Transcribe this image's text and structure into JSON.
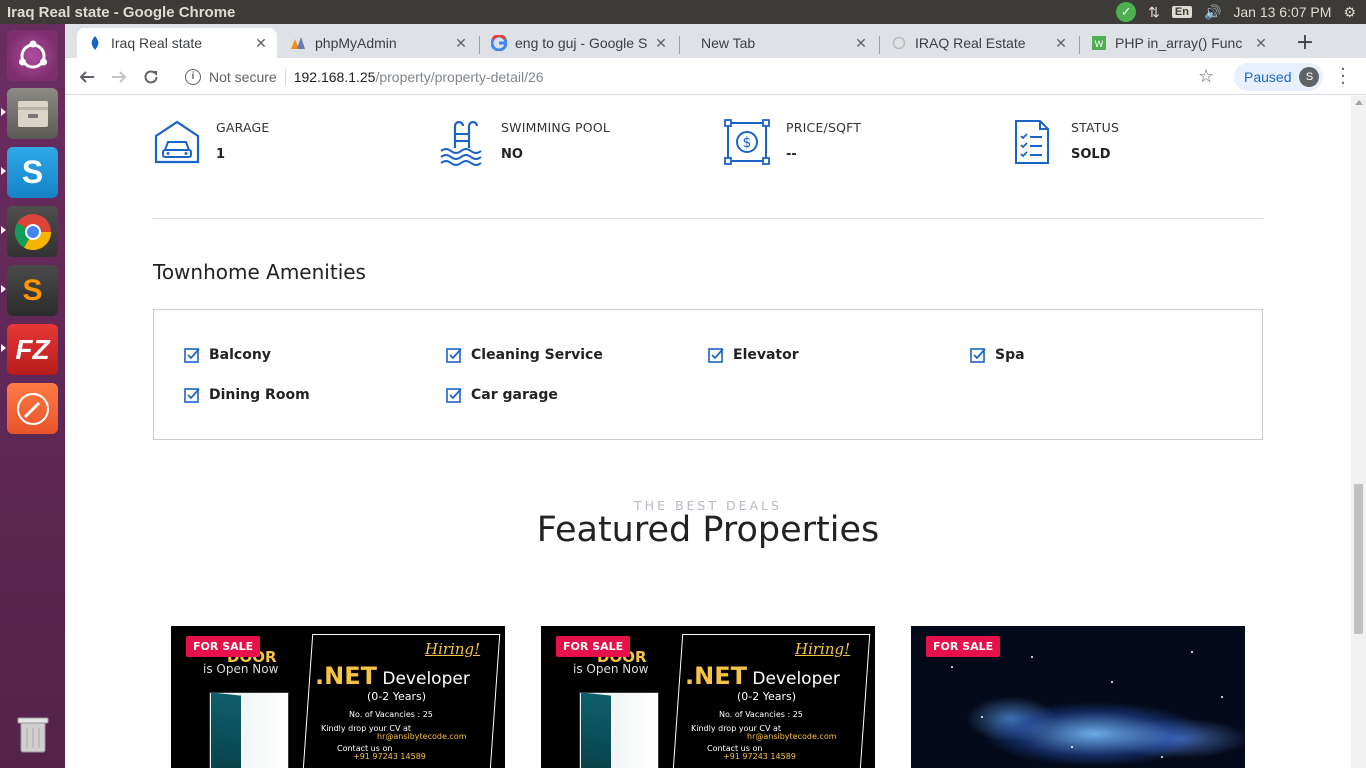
{
  "os": {
    "window_title": "Iraq Real state - Google Chrome",
    "clock": "Jan 13  6:07 PM",
    "keyboard": "En",
    "launcher": [
      "ubuntu-dash",
      "files",
      "skype",
      "chrome",
      "sublime-text",
      "filezilla",
      "postman",
      "trash"
    ]
  },
  "browser": {
    "tabs": [
      {
        "title": "Iraq Real state",
        "icon": "real-estate-favicon"
      },
      {
        "title": "phpMyAdmin",
        "icon": "phpmyadmin-favicon"
      },
      {
        "title": "eng to guj - Google S",
        "icon": "google-favicon"
      },
      {
        "title": "New Tab",
        "icon": ""
      },
      {
        "title": "IRAQ Real Estate",
        "icon": "loading-favicon"
      },
      {
        "title": "PHP in_array() Func",
        "icon": "w3-favicon"
      }
    ],
    "address": {
      "security": "Not secure",
      "host": "192.168.1.25",
      "path": "/property/property-detail/26"
    },
    "profile_status": "Paused",
    "profile_initial": "S"
  },
  "page": {
    "features": [
      {
        "label": "GARAGE",
        "value": "1",
        "icon": "garage-icon"
      },
      {
        "label": "SWIMMING POOL",
        "value": "NO",
        "icon": "pool-icon"
      },
      {
        "label": "PRICE/SQFT",
        "value": "--",
        "icon": "price-icon"
      },
      {
        "label": "STATUS",
        "value": "SOLD",
        "icon": "status-icon"
      }
    ],
    "amenities_title": "Townhome Amenities",
    "amenities": [
      "Balcony",
      "Cleaning Service",
      "Elevator",
      "Spa",
      "Dining Room",
      "Car garage"
    ],
    "deals_subtitle": "THE BEST DEALS",
    "deals_title": "Featured Properties",
    "cards": [
      {
        "badge": "FOR SALE",
        "door_title": "DOOR",
        "door_sub": "is Open Now",
        "hiring": "Hiring!",
        "net": ".NET",
        "dev": "Developer",
        "years": "(0-2 Years)",
        "vacancies": "No. of Vacancies : 25",
        "drop_cv": "Kindly drop your CV at",
        "email": "hr@ansibytecode.com",
        "contact": "Contact us on",
        "phone": "+91 97243 14589"
      },
      {
        "badge": "FOR SALE",
        "door_title": "DOOR",
        "door_sub": "is Open Now",
        "hiring": "Hiring!",
        "net": ".NET",
        "dev": "Developer",
        "years": "(0-2 Years)",
        "vacancies": "No. of Vacancies : 25",
        "drop_cv": "Kindly drop your CV at",
        "email": "hr@ansibytecode.com",
        "contact": "Contact us on",
        "phone": "+91 97243 14589"
      },
      {
        "badge": "FOR SALE"
      }
    ]
  },
  "colors": {
    "accent": "#1a64c5",
    "badge": "#e8104a",
    "launcher": "#5e2750"
  }
}
